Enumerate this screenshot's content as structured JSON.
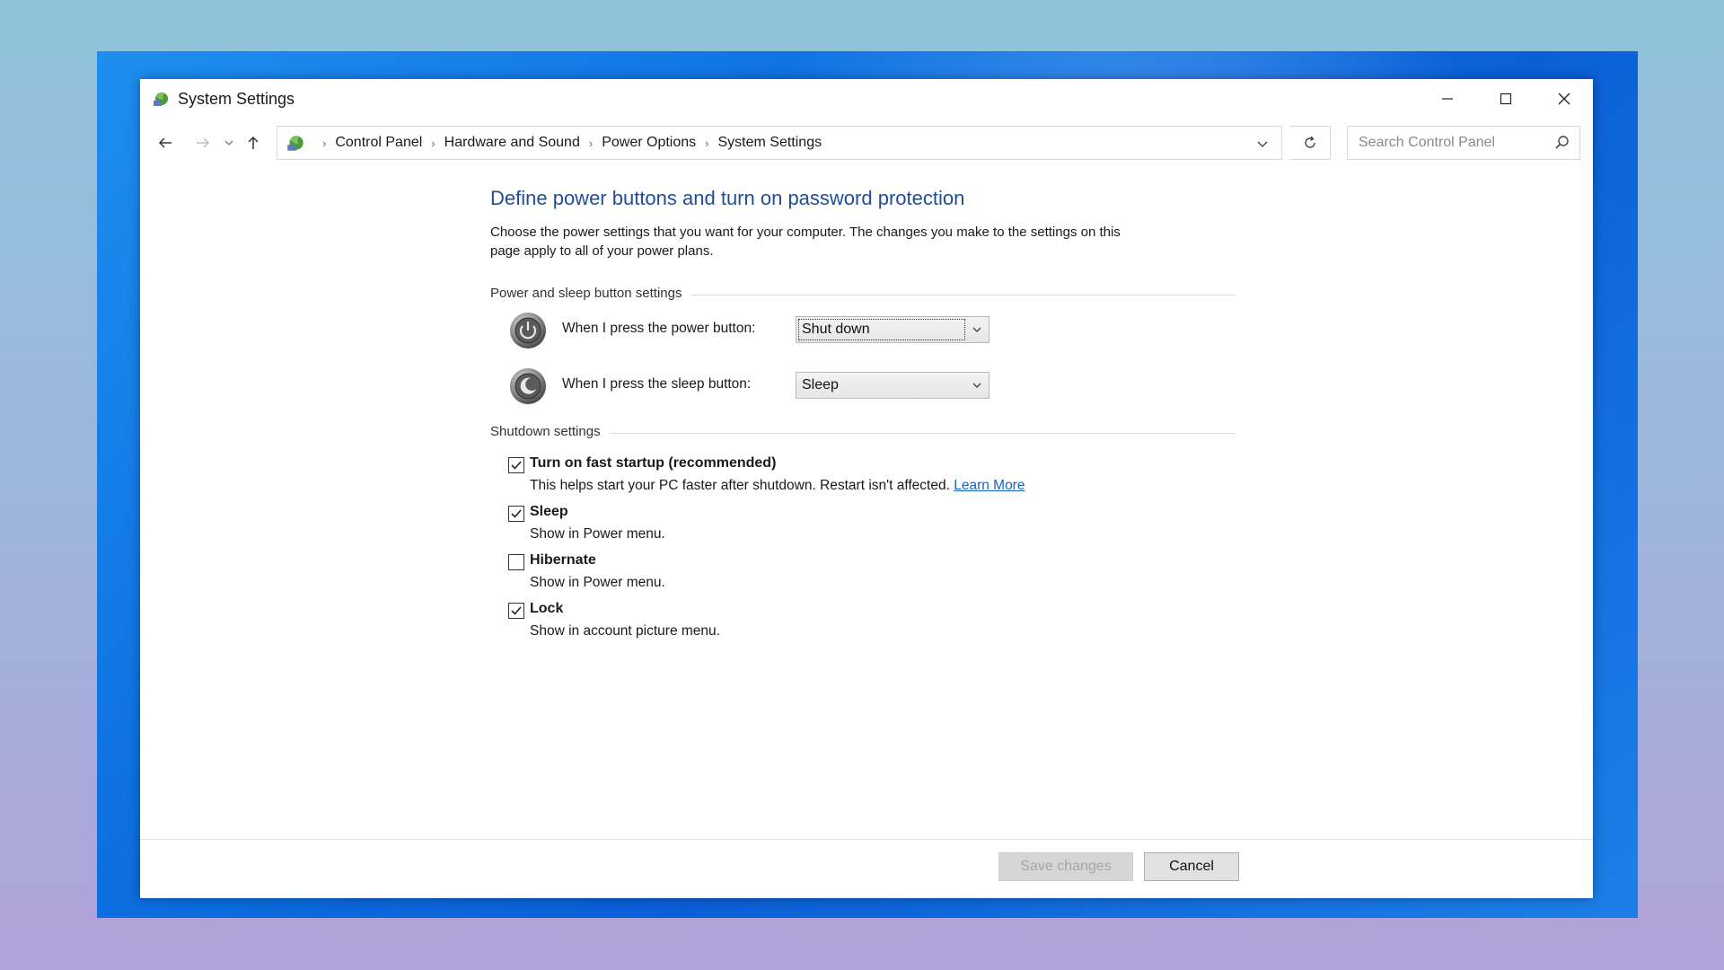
{
  "window": {
    "title": "System Settings"
  },
  "navigation": {
    "breadcrumbs": [
      "Control Panel",
      "Hardware and Sound",
      "Power Options",
      "System Settings"
    ],
    "search_placeholder": "Search Control Panel"
  },
  "main": {
    "heading": "Define power buttons and turn on password protection",
    "description_line1": "Choose the power settings that you want for your computer. The changes you make to the settings on this",
    "description_line2": "page apply to all of your power plans.",
    "power_group": {
      "title": "Power and sleep button settings",
      "power_button": {
        "label": "When I press the power button:",
        "value": "Shut down"
      },
      "sleep_button": {
        "label": "When I press the sleep button:",
        "value": "Sleep"
      }
    },
    "shutdown_group": {
      "title": "Shutdown settings",
      "items": [
        {
          "label": "Turn on fast startup (recommended)",
          "description": "This helps start your PC faster after shutdown. Restart isn't affected.",
          "link": "Learn More",
          "checked": true
        },
        {
          "label": "Sleep",
          "description": "Show in Power menu.",
          "checked": true
        },
        {
          "label": "Hibernate",
          "description": "Show in Power menu.",
          "checked": false
        },
        {
          "label": "Lock",
          "description": "Show in account picture menu.",
          "checked": true
        }
      ]
    }
  },
  "footer": {
    "save_label": "Save changes",
    "cancel_label": "Cancel"
  },
  "colors": {
    "heading": "#1e4e9a",
    "link": "#1565c0",
    "desktop_accent": "#0c6fe0"
  }
}
